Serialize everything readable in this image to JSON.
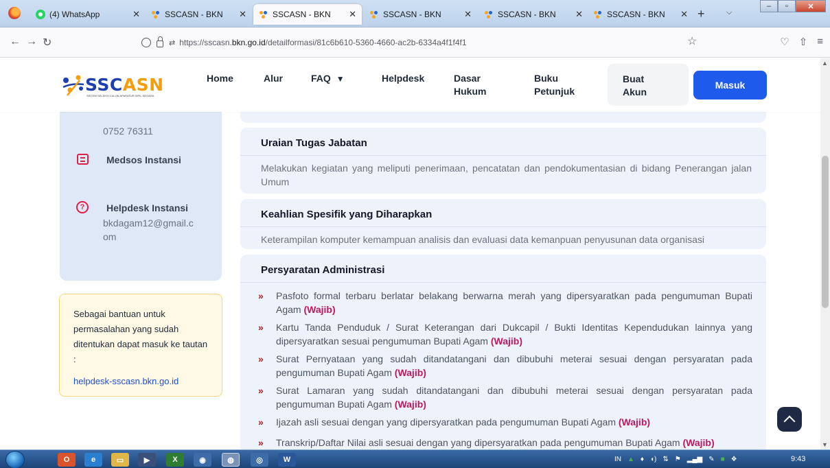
{
  "browser": {
    "tabs": [
      {
        "title": "(4) WhatsApp",
        "favicon": "whatsapp-icon",
        "active": false
      },
      {
        "title": "SSCASN - BKN",
        "favicon": "sscasn-icon",
        "active": false
      },
      {
        "title": "SSCASN - BKN",
        "favicon": "sscasn-icon",
        "active": true
      },
      {
        "title": "SSCASN - BKN",
        "favicon": "sscasn-icon",
        "active": false
      },
      {
        "title": "SSCASN - BKN",
        "favicon": "sscasn-icon",
        "active": false
      },
      {
        "title": "SSCASN - BKN",
        "favicon": "sscasn-icon",
        "active": false
      }
    ],
    "url_prefix": "https://sscasn.",
    "url_host": "bkn.go.id",
    "url_path": "/detailformasi/81c6b610-5360-4660-ac2b-6334a4f1f4f1"
  },
  "header": {
    "logo_text_a": "SSC",
    "logo_text_b": "ASN",
    "logo_sub": "SISTEM SELEKSI CALON APARATUR SIPIL NEGARA",
    "nav": {
      "home": "Home",
      "alur": "Alur",
      "faq": "FAQ",
      "helpdesk": "Helpdesk",
      "dasar_hukum_1": "Dasar",
      "dasar_hukum_2": "Hukum",
      "buku_petunjuk_1": "Buku",
      "buku_petunjuk_2": "Petunjuk",
      "buat_akun_1": "Buat",
      "buat_akun_2": "Akun",
      "masuk": "Masuk"
    }
  },
  "sidebar": {
    "phone": "0752 76311",
    "medsos_label": "Medsos Instansi",
    "helpdesk_label": "Helpdesk Instansi",
    "helpdesk_email_1": "bkdagam12@gmail.c",
    "helpdesk_email_2": "om",
    "help_card_text": "Sebagai bantuan untuk permasalahan yang sudah ditentukan dapat masuk ke tautan :",
    "help_card_link": "helpdesk-sscasn.bkn.go.id"
  },
  "main": {
    "uraian_title": "Uraian Tugas Jabatan",
    "uraian_body": "Melakukan kegiatan yang meliputi penerimaan, pencatatan dan pendokumentasian di bidang Penerangan jalan Umum",
    "keahlian_title": "Keahlian Spesifik yang Diharapkan",
    "keahlian_body": "Keterampilan komputer kemampuan analisis dan evaluasi data kemanpuan penyusunan data organisasi",
    "persyaratan_title": "Persyaratan Administrasi",
    "requirements": [
      {
        "text": "Pasfoto formal terbaru berlatar belakang berwarna merah yang dipersyaratkan pada pengumuman Bupati Agam",
        "tag": "(Wajib)"
      },
      {
        "text": "Kartu Tanda Penduduk / Surat Keterangan dari Dukcapil / Bukti Identitas Kependudukan lainnya yang dipersyaratkan sesuai pengumuman Bupati Agam",
        "tag": "(Wajib)"
      },
      {
        "text": "Surat Pernyataan yang sudah ditandatangani dan dibubuhi meterai sesuai dengan persyaratan pada pengumuman Bupati Agam",
        "tag": "(Wajib)"
      },
      {
        "text": "Surat Lamaran yang sudah ditandatangani dan dibubuhi meterai sesuai dengan persyaratan pada pengumuman Bupati Agam",
        "tag": "(Wajib)"
      },
      {
        "text": "Ijazah asli sesuai dengan yang dipersyaratkan pada pengumuman Bupati Agam",
        "tag": "(Wajib)"
      },
      {
        "text": "Transkrip/Daftar Nilai asli sesuai dengan yang dipersyaratkan pada pengumuman Bupati Agam",
        "tag": "(Wajib)"
      }
    ]
  },
  "taskbar": {
    "lang": "IN",
    "clock": "9:43"
  },
  "colors": {
    "brand_blue": "#1f5bea",
    "wajib_pink": "#be185d",
    "arrow_red": "#b91c1c",
    "sidebar_bg": "#dfe8f6",
    "card_bg": "#eef2fb"
  }
}
